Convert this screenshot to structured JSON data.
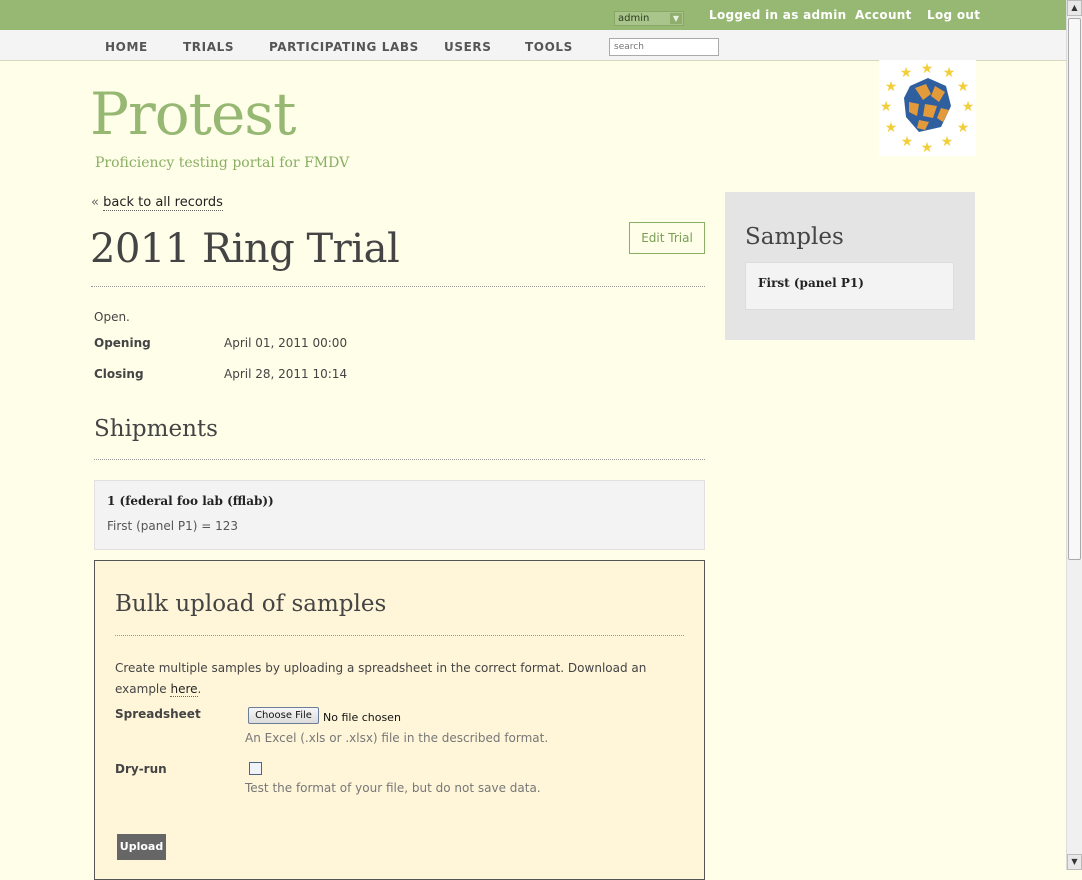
{
  "topbar": {
    "user_select": "admin",
    "logged_in": "Logged in as admin",
    "account": "Account",
    "logout": "Log out"
  },
  "nav": {
    "items": [
      "HOME",
      "TRIALS",
      "PARTICIPATING LABS",
      "USERS",
      "TOOLS"
    ],
    "search_placeholder": "search"
  },
  "site": {
    "logo": "Protest",
    "tagline": "Proficiency testing portal for FMDV"
  },
  "back": {
    "prefix": "«",
    "link": "back to all records"
  },
  "trial": {
    "title": "2011 Ring Trial",
    "edit_label": "Edit Trial",
    "status": "Open.",
    "opening_label": "Opening",
    "opening_value": "April 01, 2011 00:00",
    "closing_label": "Closing",
    "closing_value": "April 28, 2011 10:14"
  },
  "shipments": {
    "heading": "Shipments",
    "items": [
      {
        "title": "1 (federal foo lab (fflab))",
        "line": "First (panel P1) = 123"
      }
    ]
  },
  "bulk": {
    "heading": "Bulk upload of samples",
    "intro": "Create multiple samples by uploading a spreadsheet in the correct format. Download an example",
    "intro_link": "here",
    "intro_end": ".",
    "spreadsheet_label": "Spreadsheet",
    "choose_file": "Choose File",
    "no_file": "No file chosen",
    "spreadsheet_hint": "An Excel (.xls or .xlsx) file in the described format.",
    "dryrun_label": "Dry-run",
    "dryrun_hint": "Test the format of your file, but do not save data.",
    "upload_label": "Upload"
  },
  "samples": {
    "heading": "Samples",
    "items": [
      "First (panel P1)"
    ]
  },
  "colors": {
    "brand_green": "#97b873",
    "page_bg": "#fefee9",
    "panel_bg": "#e4e4e4",
    "bulk_bg": "#fff6d9"
  }
}
